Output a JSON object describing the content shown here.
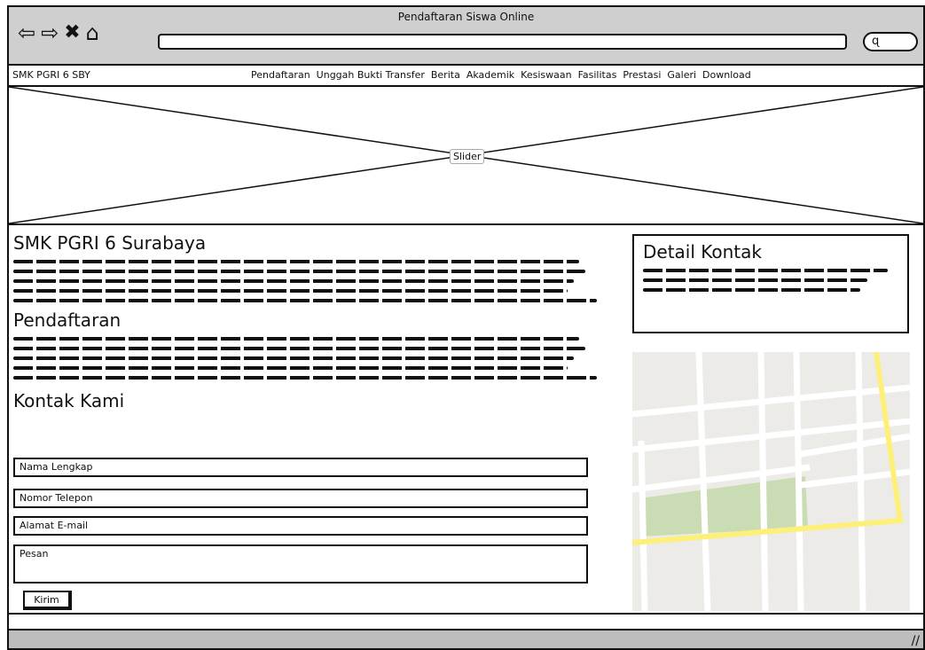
{
  "window": {
    "title": "Pendaftaran Siswa Online"
  },
  "toolbar": {
    "icons": [
      "back-arrow-icon",
      "forward-arrow-icon",
      "close-icon",
      "home-icon"
    ],
    "url_value": "",
    "search_icon": "search-icon"
  },
  "nav": {
    "brand": "SMK PGRI 6 SBY",
    "items": [
      {
        "label": "Pendaftaran"
      },
      {
        "label": "Unggah Bukti Transfer"
      },
      {
        "label": "Berita"
      },
      {
        "label": "Akademik"
      },
      {
        "label": "Kesiswaan"
      },
      {
        "label": "Fasilitas"
      },
      {
        "label": "Prestasi"
      },
      {
        "label": "Galeri"
      },
      {
        "label": "Download"
      }
    ]
  },
  "slider": {
    "label": "Slider"
  },
  "main": {
    "title": "SMK PGRI 6 Surabaya",
    "section2_title": "Pendaftaran",
    "contact_title": "Kontak Kami",
    "fields": {
      "name": "Nama Lengkap",
      "phone": "Nomor Telepon",
      "email": "Alamat E-mail",
      "message": "Pesan"
    },
    "submit": "Kirim"
  },
  "sidebar": {
    "detail_title": "Detail Kontak",
    "map_icon": "map-placeholder"
  }
}
